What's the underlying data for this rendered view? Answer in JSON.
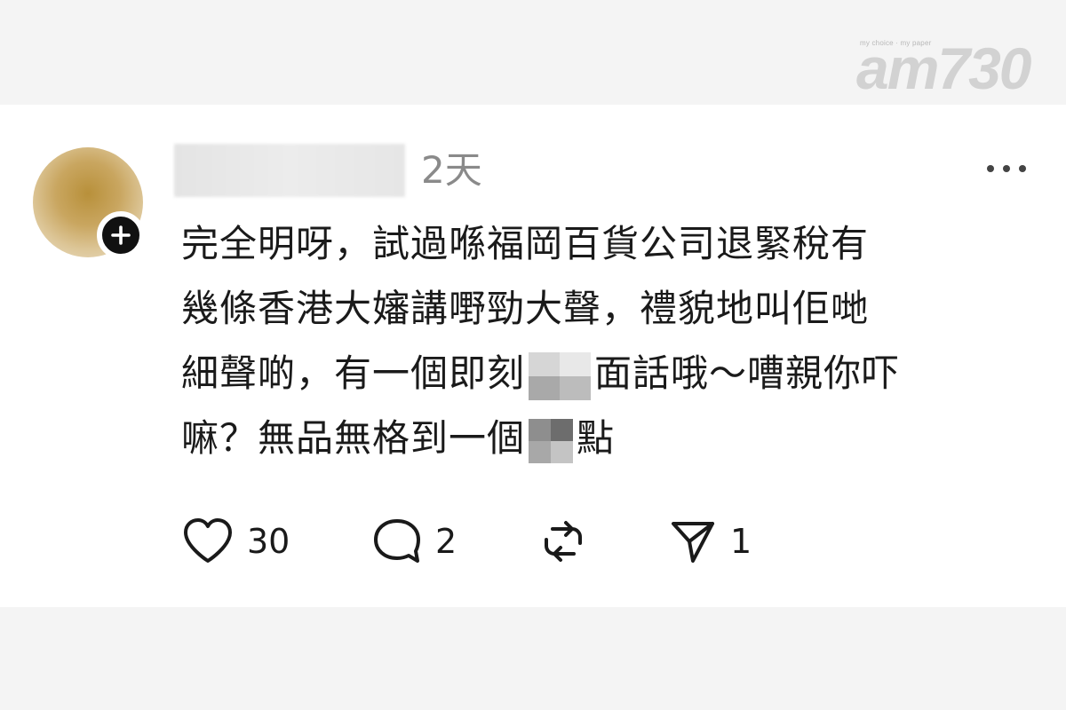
{
  "watermark": {
    "logo_text": "am730",
    "tagline": "my choice · my paper"
  },
  "post": {
    "time": "2天",
    "content_lines": [
      [
        "完全明呀，試過喺福岡百貨公司退緊稅有"
      ],
      [
        "幾條香港大嬸講嘢勁大聲，禮貌地叫佢哋"
      ],
      [
        "細聲啲，有一個即刻",
        "面話哦～嘈親你吓"
      ],
      [
        "嘛？無品無格到一個",
        "點"
      ]
    ],
    "actions": {
      "like": {
        "icon": "heart-icon",
        "count": "30"
      },
      "comment": {
        "icon": "comment-icon",
        "count": "2"
      },
      "repost": {
        "icon": "repost-icon",
        "count": ""
      },
      "share": {
        "icon": "send-icon",
        "count": "1"
      }
    }
  },
  "colors": {
    "text": "#1a1a1a",
    "muted": "#8a8a8a",
    "page_bg": "#f4f4f4",
    "card_bg": "#ffffff"
  }
}
